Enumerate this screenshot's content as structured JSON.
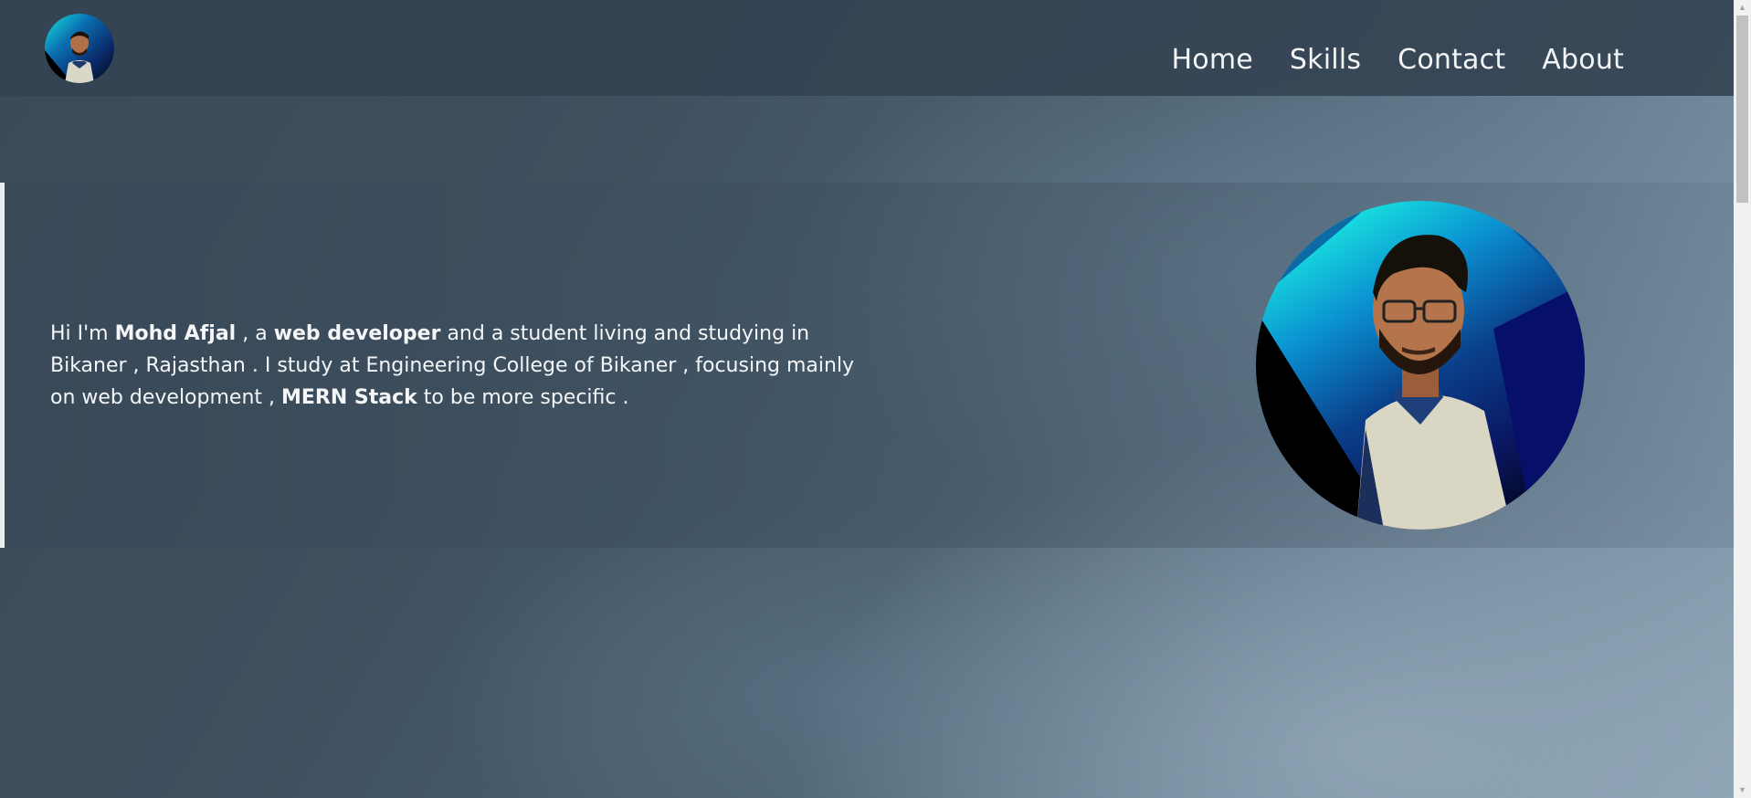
{
  "nav": {
    "items": [
      {
        "label": "Home"
      },
      {
        "label": "Skills"
      },
      {
        "label": "Contact"
      },
      {
        "label": "About"
      }
    ]
  },
  "hero": {
    "intro": {
      "p1": "Hi I'm ",
      "name": "Mohd Afjal",
      "p2": " , a ",
      "role": "web developer",
      "p3": " and a student living and studying in Bikaner , Rajasthan . I study at Engineering College of Bikaner , focusing mainly on web development , ",
      "stack": "MERN Stack",
      "p4": " to be more specific ."
    }
  },
  "colors": {
    "header_bg": "#344352",
    "text": "#f4f6f8",
    "portrait_accent": "#19e6e0",
    "portrait_dark": "#0a1a5a"
  },
  "icons": {
    "logo": "avatar-logo",
    "portrait": "profile-portrait"
  }
}
